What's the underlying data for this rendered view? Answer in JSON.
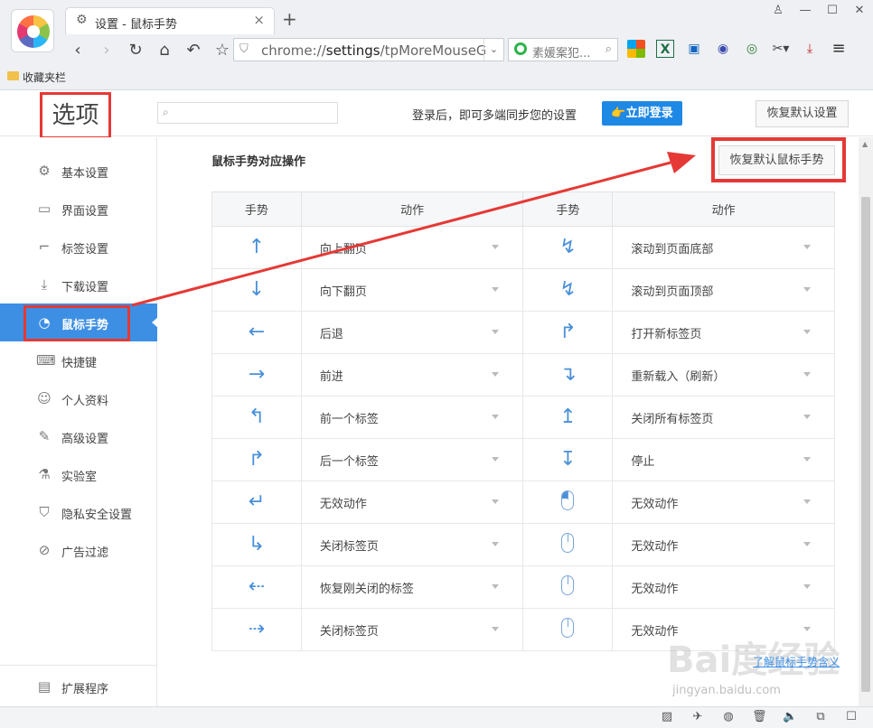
{
  "browser": {
    "tab_title": "设置 - 鼠标手势",
    "url_prefix": "chrome://",
    "url_main": "settings",
    "url_rest": "/tpMoreMouseGes",
    "search_query": "素媛案犯...",
    "bookmarks_label": "收藏夹栏",
    "icons": {
      "back": "‹",
      "forward": "›",
      "reload": "↻",
      "home": "⌂",
      "undo": "↶",
      "star": "☆",
      "new_tab": "+",
      "close_tab": "×",
      "menu": "≡"
    }
  },
  "header": {
    "title": "选项",
    "login_tip": "登录后，即可多端同步您的设置",
    "login_button": "👉立即登录",
    "restore_all": "恢复默认设置"
  },
  "sidebar": {
    "items": [
      {
        "label": "基本设置",
        "icon": "⚙"
      },
      {
        "label": "界面设置",
        "icon": "▭"
      },
      {
        "label": "标签设置",
        "icon": "⌐"
      },
      {
        "label": "下载设置",
        "icon": "⤓"
      },
      {
        "label": "鼠标手势",
        "icon": "◔"
      },
      {
        "label": "快捷键",
        "icon": "⌨"
      },
      {
        "label": "个人资料",
        "icon": "☺"
      },
      {
        "label": "高级设置",
        "icon": "✎"
      },
      {
        "label": "实验室",
        "icon": "⚗"
      },
      {
        "label": "隐私安全设置",
        "icon": "⛉"
      },
      {
        "label": "广告过滤",
        "icon": "⊘"
      }
    ],
    "extensions": {
      "label": "扩展程序",
      "icon": "▤"
    }
  },
  "main": {
    "section_title": "鼠标手势对应操作",
    "restore_gesture": "恢复默认鼠标手势",
    "columns": [
      "手势",
      "动作",
      "手势",
      "动作"
    ],
    "rows": [
      {
        "g1": "↑",
        "a1": "向上翻页",
        "g2": "↯",
        "a2": "滚动到页面底部"
      },
      {
        "g1": "↓",
        "a1": "向下翻页",
        "g2": "↯",
        "a2": "滚动到页面顶部"
      },
      {
        "g1": "←",
        "a1": "后退",
        "g2": "↱",
        "a2": "打开新标签页"
      },
      {
        "g1": "→",
        "a1": "前进",
        "g2": "↴",
        "a2": "重新载入（刷新）"
      },
      {
        "g1": "↰",
        "a1": "前一个标签",
        "g2": "↥",
        "a2": "关闭所有标签页"
      },
      {
        "g1": "↱",
        "a1": "后一个标签",
        "g2": "↧",
        "a2": "停止"
      },
      {
        "g1": "↵",
        "a1": "无效动作",
        "g2": "mouse-left",
        "a2": "无效动作"
      },
      {
        "g1": "↳",
        "a1": "关闭标签页",
        "g2": "mouse",
        "a2": "无效动作"
      },
      {
        "g1": "⇠",
        "a1": "恢复刚关闭的标签",
        "g2": "mouse",
        "a2": "无效动作"
      },
      {
        "g1": "⇢",
        "a1": "关闭标签页",
        "g2": "mouse",
        "a2": "无效动作"
      }
    ],
    "help_link": "了解鼠标手势含义"
  },
  "watermark": {
    "text": "Bai度经验",
    "sub": "jingyan.baidu.com"
  },
  "colors": {
    "accent": "#3d8fe4",
    "annotation": "#e53935"
  }
}
